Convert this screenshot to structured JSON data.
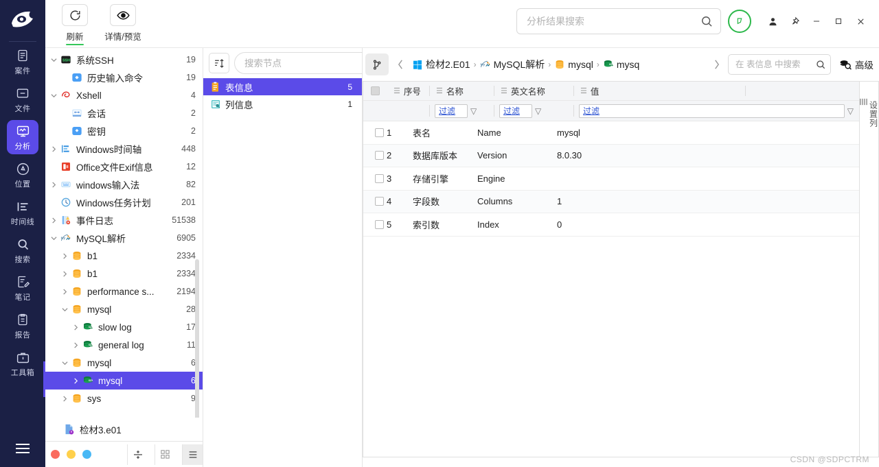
{
  "app": {
    "logo_icon": "leaf-eye-logo",
    "watermark": "CSDN @SDPCTRM"
  },
  "rail": {
    "items": [
      {
        "label": "案件",
        "icon": "case-file-icon",
        "name": "sidebar-item-case",
        "active": false
      },
      {
        "label": "文件",
        "icon": "folder-icon",
        "name": "sidebar-item-files",
        "active": false
      },
      {
        "label": "分析",
        "icon": "analysis-monitor-icon",
        "name": "sidebar-item-analysis",
        "active": true
      },
      {
        "label": "位置",
        "icon": "location-pin-icon",
        "name": "sidebar-item-location",
        "active": false
      },
      {
        "label": "时间线",
        "icon": "timeline-icon",
        "name": "sidebar-item-timeline",
        "active": false
      },
      {
        "label": "搜索",
        "icon": "search-icon",
        "name": "sidebar-item-search",
        "active": false
      },
      {
        "label": "笔记",
        "icon": "notes-pen-icon",
        "name": "sidebar-item-notes",
        "active": false
      },
      {
        "label": "报告",
        "icon": "report-clipboard-icon",
        "name": "sidebar-item-report",
        "active": false
      },
      {
        "label": "工具箱",
        "icon": "toolbox-icon",
        "name": "sidebar-item-toolbox",
        "active": false
      }
    ],
    "menu_icon": "hamburger-menu-icon",
    "active_color": "#5b4be8",
    "background_color": "#1b2045"
  },
  "toolbar": {
    "refresh_label": "刷新",
    "refresh_icon": "refresh-circular-arrow-icon",
    "detail_label": "详情/预览",
    "detail_icon": "eye-icon",
    "accent_color": "#35c759"
  },
  "topsearch": {
    "placeholder": "分析结果搜索",
    "value": "",
    "icon": "search-icon"
  },
  "window": {
    "notify_icon": "bell-circle-icon",
    "notify_color": "#2cb84a",
    "user_icon": "user-icon",
    "pin_icon": "pin-icon",
    "minimize_icon": "minimize-icon",
    "maximize_icon": "maximize-icon",
    "close_icon": "close-icon"
  },
  "tree": {
    "nodes": [
      {
        "label": "系统SSH",
        "count": "19",
        "indent": 0,
        "caret": "down",
        "icon": "ssh-icon",
        "selected": false
      },
      {
        "label": "历史输入命令",
        "count": "19",
        "indent": 1,
        "caret": "none",
        "icon": "blue-circle-icon",
        "selected": false
      },
      {
        "label": "Xshell",
        "count": "4",
        "indent": 0,
        "caret": "down",
        "icon": "xshell-icon",
        "selected": false
      },
      {
        "label": "会话",
        "count": "2",
        "indent": 1,
        "caret": "none",
        "icon": "session-icon",
        "selected": false
      },
      {
        "label": "密钥",
        "count": "2",
        "indent": 1,
        "caret": "none",
        "icon": "key-icon",
        "selected": false
      },
      {
        "label": "Windows时间轴",
        "count": "448",
        "indent": 0,
        "caret": "right",
        "icon": "timeline-bars-icon",
        "selected": false
      },
      {
        "label": "Office文件Exif信息",
        "count": "12",
        "indent": 0,
        "caret": "none",
        "icon": "office-icon",
        "selected": false
      },
      {
        "label": "windows输入法",
        "count": "82",
        "indent": 0,
        "caret": "right",
        "icon": "keyboard-icon",
        "selected": false
      },
      {
        "label": "Windows任务计划",
        "count": "201",
        "indent": 0,
        "caret": "none",
        "icon": "clock-icon",
        "selected": false
      },
      {
        "label": "事件日志",
        "count": "51538",
        "indent": 0,
        "caret": "right",
        "icon": "eventlog-icon",
        "selected": false
      },
      {
        "label": "MySQL解析",
        "count": "6905",
        "indent": 0,
        "caret": "down",
        "icon": "mysql-icon",
        "selected": false
      },
      {
        "label": "b1",
        "count": "2334",
        "indent": 1,
        "caret": "right",
        "icon": "database-icon",
        "selected": false
      },
      {
        "label": "b1",
        "count": "2334",
        "indent": 1,
        "caret": "right",
        "icon": "database-icon",
        "selected": false
      },
      {
        "label": "performance s...",
        "count": "2194",
        "indent": 1,
        "caret": "right",
        "icon": "database-icon",
        "selected": false
      },
      {
        "label": "mysql",
        "count": "28",
        "indent": 1,
        "caret": "down",
        "icon": "database-icon",
        "selected": false
      },
      {
        "label": "slow log",
        "count": "17",
        "indent": 2,
        "caret": "right",
        "icon": "table-icon",
        "selected": false
      },
      {
        "label": "general log",
        "count": "11",
        "indent": 2,
        "caret": "right",
        "icon": "table-icon",
        "selected": false
      },
      {
        "label": "mysql",
        "count": "6",
        "indent": 1,
        "caret": "down",
        "icon": "database-icon",
        "selected": false
      },
      {
        "label": "mysql",
        "count": "6",
        "indent": 2,
        "caret": "right",
        "icon": "table-icon",
        "selected": true
      },
      {
        "label": "sys",
        "count": "9",
        "indent": 1,
        "caret": "right",
        "icon": "database-icon",
        "selected": false
      }
    ],
    "file_item": {
      "label": "检材3.e01",
      "icon": "evidence-file-icon"
    },
    "footer": {
      "dots": [
        "#fa6b5e",
        "#ffd04b",
        "#49b8f5"
      ],
      "split_icon": "split-view-icon",
      "grid_icon": "grid-view-icon",
      "list_icon": "list-view-icon"
    }
  },
  "nodepanel": {
    "sort_icon": "sort-icon",
    "search_placeholder": "搜索节点",
    "search_value": "",
    "search_icon": "search-icon",
    "items": [
      {
        "label": "表信息",
        "count": "5",
        "icon": "table-info-icon",
        "selected": true
      },
      {
        "label": "列信息",
        "count": "1",
        "icon": "column-info-icon",
        "selected": false
      }
    ]
  },
  "breadcrumb": {
    "branch_icon": "branch-tree-icon",
    "back_icon": "chevron-left-icon",
    "forward_icon": "chevron-right-icon",
    "items": [
      {
        "label": "检材2.E01",
        "icon": "windows-icon"
      },
      {
        "label": "MySQL解析",
        "icon": "mysql-icon"
      },
      {
        "label": "mysql",
        "icon": "database-icon"
      },
      {
        "label": "mysq",
        "icon": "table-icon"
      }
    ],
    "separator": "›"
  },
  "tablesearch": {
    "placeholder": "在 表信息 中搜索",
    "value": "",
    "icon": "search-icon",
    "advanced_label": "高级",
    "advanced_icon": "advanced-filter-icon"
  },
  "table": {
    "columns": [
      {
        "label": "序号",
        "name": "col-index"
      },
      {
        "label": "名称",
        "name": "col-name-cn"
      },
      {
        "label": "英文名称",
        "name": "col-name-en"
      },
      {
        "label": "值",
        "name": "col-value"
      },
      {
        "label": "",
        "name": "col-extra"
      }
    ],
    "filter_placeholder": "过滤",
    "filters": [
      "过滤",
      "过滤",
      "过滤"
    ],
    "rows": [
      {
        "index": "1",
        "name_cn": "表名",
        "name_en": "Name",
        "value": "mysql"
      },
      {
        "index": "2",
        "name_cn": "数据库版本",
        "name_en": "Version",
        "value": "8.0.30"
      },
      {
        "index": "3",
        "name_cn": "存储引擎",
        "name_en": "Engine",
        "value": ""
      },
      {
        "index": "4",
        "name_cn": "字段数",
        "name_en": "Columns",
        "value": "1"
      },
      {
        "index": "5",
        "name_cn": "索引数",
        "name_en": "Index",
        "value": "0"
      }
    ]
  },
  "colsettings": {
    "label": "设置列",
    "icon": "columns-icon"
  }
}
